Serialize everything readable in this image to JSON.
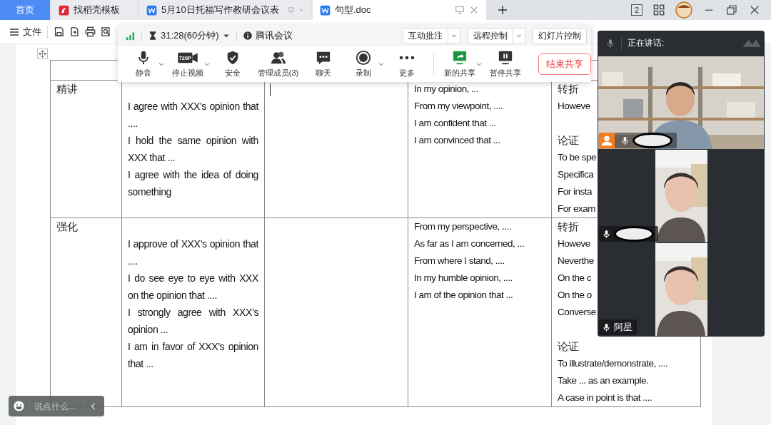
{
  "tabs": [
    {
      "kind": "home",
      "label": "首页",
      "selected": false
    },
    {
      "kind": "docer",
      "label": "找稻壳模板",
      "selected": false
    },
    {
      "kind": "doc",
      "label": "5月10日托福写作教研会议表",
      "selected": false
    },
    {
      "kind": "doc",
      "label": "句型.doc",
      "selected": true
    }
  ],
  "window_count": "2",
  "file_menu": "文件",
  "meeting_toolbar": {
    "timer": "31:28(60分钟)",
    "app_name": "腾讯会议",
    "top_buttons": [
      {
        "label": "互动批注",
        "dropdown": true
      },
      {
        "label": "远程控制",
        "dropdown": true
      },
      {
        "label": "幻灯片控制",
        "dropdown": false
      }
    ],
    "tools": [
      {
        "label": "静音",
        "dropdown": true,
        "divider_before": false
      },
      {
        "badge": "720P",
        "label": "停止视频",
        "dropdown": true,
        "divider_before": false
      },
      {
        "label": "安全",
        "dropdown": false,
        "divider_before": false
      },
      {
        "label": "管理成员(3)",
        "dropdown": false,
        "divider_before": false
      },
      {
        "label": "聊天",
        "dropdown": false,
        "divider_before": false
      },
      {
        "label": "录制",
        "dropdown": true,
        "divider_before": false
      },
      {
        "label": "更多",
        "dropdown": false,
        "divider_before": false
      },
      {
        "label": "新的共享",
        "dropdown": true,
        "divider_before": true
      },
      {
        "label": "暂停共享",
        "dropdown": false,
        "divider_before": false
      }
    ],
    "end_button": "结束共享"
  },
  "table": {
    "rows": [
      {
        "cells": [
          {
            "cursor": false,
            "paragraphs": [
              {
                "kind": "heading",
                "text": "精讲",
                "gap_before": false
              }
            ]
          },
          {
            "cursor": false,
            "paragraphs": [
              {
                "kind": "body",
                "text": "I agree with XXX’s opinion that ....",
                "gap_before": true
              },
              {
                "kind": "body",
                "text": "I hold the same opinion with XXX that ...",
                "gap_before": false
              },
              {
                "kind": "body",
                "text": "I agree with the idea of doing something",
                "gap_before": false
              }
            ]
          },
          {
            "cursor": true
          },
          {
            "cursor": false,
            "paragraphs": [
              {
                "kind": "line",
                "text": "In my opinion, ...",
                "gap_before": false
              },
              {
                "kind": "line",
                "text": "From my viewpoint, ....",
                "gap_before": false
              },
              {
                "kind": "line",
                "text": "I am confident that ...",
                "gap_before": false
              },
              {
                "kind": "line",
                "text": "I am convinced that ...",
                "gap_before": false
              }
            ]
          },
          {
            "cursor": false,
            "paragraphs": [
              {
                "kind": "heading",
                "text": "转折",
                "gap_before": false
              },
              {
                "kind": "line",
                "text": "Howeve",
                "gap_before": false
              },
              {
                "kind": "heading",
                "text": "论证",
                "gap_before": true
              },
              {
                "kind": "line",
                "text": "To be spe",
                "gap_before": false
              },
              {
                "kind": "line",
                "text": "Specifica",
                "gap_before": false
              },
              {
                "kind": "line",
                "text": "For insta",
                "gap_before": false
              },
              {
                "kind": "line",
                "text": "For exam",
                "gap_before": false
              }
            ]
          }
        ]
      },
      {
        "cells": [
          {
            "cursor": false,
            "paragraphs": [
              {
                "kind": "heading",
                "text": "强化",
                "gap_before": false
              }
            ]
          },
          {
            "cursor": false,
            "paragraphs": [
              {
                "kind": "body",
                "text": "I approve of XXX’s opinion that ....",
                "gap_before": true
              },
              {
                "kind": "body",
                "text": "I do see eye to eye with XXX on the opinion that ....",
                "gap_before": false
              },
              {
                "kind": "body",
                "text": "I strongly agree with XXX’s opinion ...",
                "gap_before": false
              },
              {
                "kind": "body",
                "text": "I am in favor of XXX’s opinion that ...",
                "gap_before": false
              }
            ]
          },
          {
            "cursor": false
          },
          {
            "cursor": false,
            "paragraphs": [
              {
                "kind": "line",
                "text": "From my perspective, ....",
                "gap_before": false
              },
              {
                "kind": "line",
                "text": "As far as I am concerned, ...",
                "gap_before": false
              },
              {
                "kind": "line",
                "text": "From where I stand, ....",
                "gap_before": false
              },
              {
                "kind": "line",
                "text": "In my humble opinion, ....",
                "gap_before": false
              },
              {
                "kind": "line",
                "text": "I am of the opinion that ...",
                "gap_before": false
              }
            ]
          },
          {
            "cursor": false,
            "paragraphs": [
              {
                "kind": "heading",
                "text": "转折",
                "gap_before": false
              },
              {
                "kind": "line",
                "text": "Howeve",
                "gap_before": false
              },
              {
                "kind": "line",
                "text": "Neverthe",
                "gap_before": false
              },
              {
                "kind": "line",
                "text": "On the c",
                "gap_before": false
              },
              {
                "kind": "line",
                "text": "On the o",
                "gap_before": false
              },
              {
                "kind": "line",
                "text": "Converse",
                "gap_before": false
              },
              {
                "kind": "heading",
                "text": "论证",
                "gap_before": true
              },
              {
                "kind": "line",
                "text": "To illustrate/demonstrate, ....",
                "gap_before": false
              },
              {
                "kind": "line",
                "text": "Take ... as an example.",
                "gap_before": false
              },
              {
                "kind": "line",
                "text": "A case in point is that ....",
                "gap_before": false
              }
            ]
          }
        ]
      }
    ]
  },
  "video_panel": {
    "speaking_label": "正在讲话:",
    "participants": [
      {
        "host": true,
        "name_hidden": true
      },
      {
        "host": false,
        "name_hidden": true
      },
      {
        "host": false,
        "name_hidden": false,
        "name": "阿星"
      }
    ]
  },
  "chat": {
    "placeholder": "说点什么..."
  }
}
